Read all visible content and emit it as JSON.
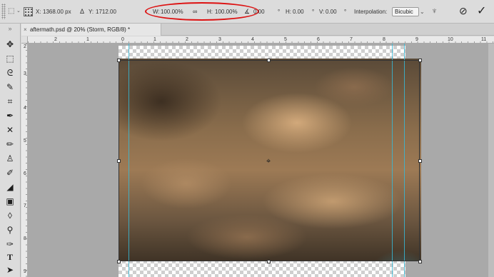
{
  "options_bar": {
    "x_label": "X:",
    "x_value": "1368.00 px",
    "delta_icon": "delta-triangle",
    "y_label": "Y:",
    "y_value": "1712.00",
    "w_label": "W:",
    "w_value": "100.00%",
    "link_icon": "chain-link",
    "h_label": "H:",
    "h_value": "100.00%",
    "angle_icon": "angle",
    "angle_value": "0.00",
    "degree_symbol": "°",
    "skew_h_label": "H:",
    "skew_h_value": "0.00",
    "skew_v_label": "V:",
    "skew_v_value": "0.00",
    "interpolation_label": "Interpolation:",
    "interpolation_value": "Bicubic",
    "cancel_icon": "cancel-circle-slash",
    "commit_icon": "checkmark",
    "highlight_color": "#dd1111"
  },
  "document_tab": {
    "close_glyph": "×",
    "title": "aftermath.psd @ 20% (Storm, RGB/8) *"
  },
  "ruler": {
    "horizontal_numbers": [
      "2",
      "1",
      "0",
      "1",
      "2",
      "3",
      "4",
      "5",
      "6",
      "7",
      "8",
      "9",
      "10",
      "11"
    ],
    "vertical_numbers": [
      "2",
      "3",
      "4",
      "5",
      "6",
      "7",
      "8",
      "9"
    ]
  },
  "tools": [
    "move",
    "marquee",
    "lasso",
    "quick-selection",
    "crop",
    "eyedropper",
    "healing-brush",
    "brush",
    "clone-stamp",
    "history-brush",
    "eraser",
    "gradient",
    "blur",
    "dodge",
    "pen",
    "type",
    "path-selection"
  ],
  "colors": {
    "guide": "#37b9d6",
    "canvas_bg": "#a9a9a9"
  }
}
